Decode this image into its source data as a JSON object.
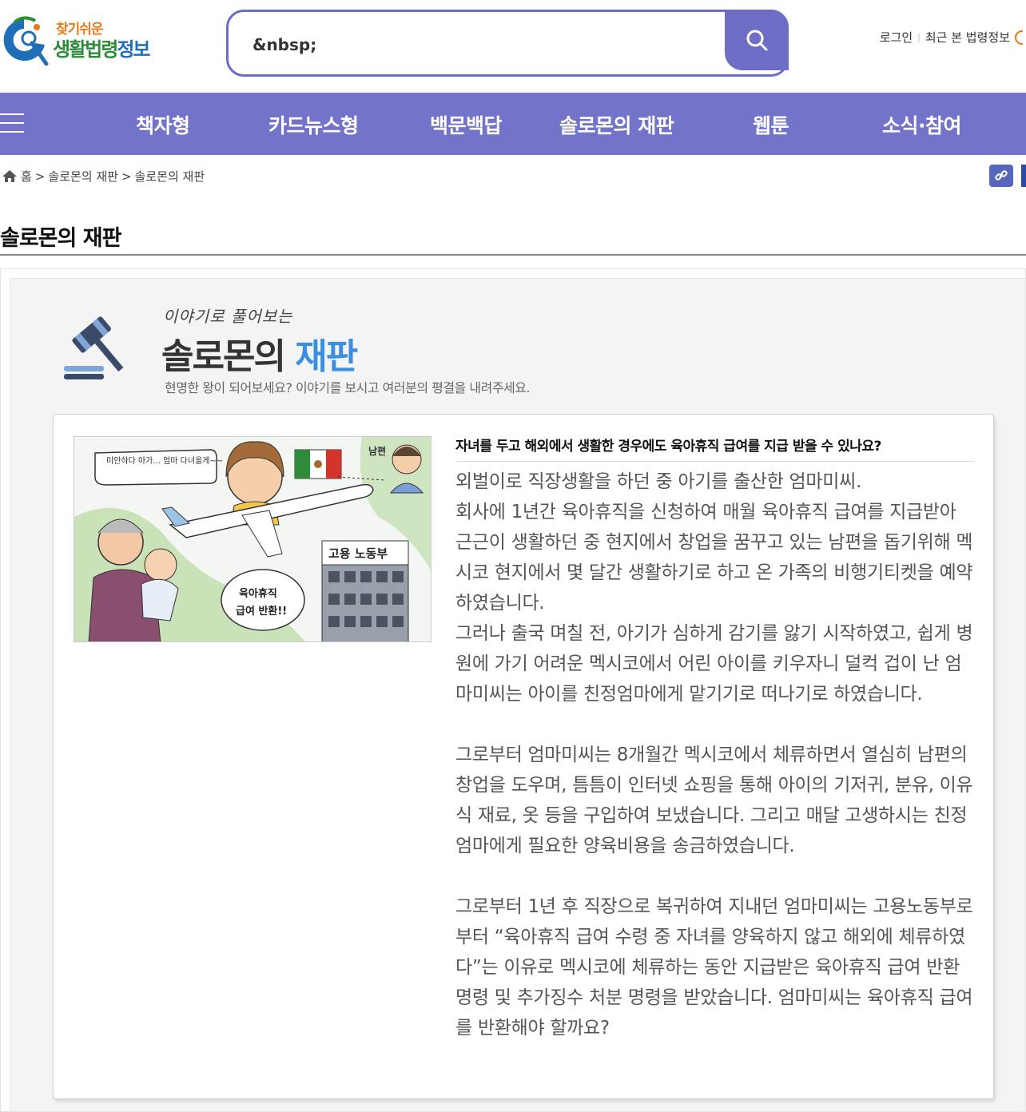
{
  "logo": {
    "top": "찾기쉬운",
    "main_green": "생활법령",
    "main_blue": "정보"
  },
  "search": {
    "value": "&nbsp;",
    "placeholder": ""
  },
  "util": {
    "login": "로그인",
    "recent": "최근 본 법령정보"
  },
  "nav": {
    "items": [
      "책자형",
      "카드뉴스형",
      "백문백답",
      "솔로몬의 재판",
      "웹툰",
      "소식·참여"
    ]
  },
  "breadcrumb": {
    "home": "홈",
    "sep": ">",
    "level1": "솔로몬의 재판",
    "level2": "솔로몬의 재판"
  },
  "page_title": "솔로몬의 재판",
  "banner": {
    "subtitle": "이야기로 풀어보는",
    "title_main": "솔로몬의",
    "title_accent": "재판",
    "description": "현명한 왕이 되어보세요? 이야기를 보시고 여러분의 평결을 내려주세요."
  },
  "cartoon": {
    "speech1": "미안하다 아가... 엄마 다녀올게~~",
    "husband_label": "남편",
    "ministry": "고용 노동부",
    "speech2a": "육아휴직",
    "speech2b": "급여 반환!!"
  },
  "question": "자녀를 두고 해외에서 생활한 경우에도 육아휴직 급여를 지급 받을 수 있나요?",
  "story": {
    "p1": [
      "외벌이로 직장생활을 하던 중 아기를 출산한 엄마미씨.",
      "회사에 1년간 육아휴직을 신청하여 매월 육아휴직 급여를 지급받아 근근이 생활하던 중 현지에서 창업을 꿈꾸고 있는 남편을 돕기위해 멕시코 현지에서 몇 달간 생활하기로 하고 온 가족의 비행기티켓을 예약하였습니다.",
      "그러나 출국 며칠 전, 아기가 심하게 감기를 앓기 시작하였고, 쉽게 병원에 가기 어려운 멕시코에서 어린 아이를 키우자니 덜컥 겁이 난 엄마미씨는 아이를 친정엄마에게 맡기기로 떠나기로 하였습니다."
    ],
    "p2": "그로부터 엄마미씨는 8개월간 멕시코에서 체류하면서 열심히 남편의 창업을 도우며, 틈틈이 인터넷 쇼핑을 통해 아이의 기저귀, 분유, 이유식 재료, 옷 등을 구입하여 보냈습니다. 그리고 매달 고생하시는 친정엄마에게 필요한 양육비용을 송금하였습니다.",
    "p3": "그로부터 1년 후 직장으로 복귀하여 지내던 엄마미씨는 고용노동부로부터 “육아휴직 급여 수령 중 자녀를 양육하지 않고 해외에 체류하였다”는 이유로 멕시코에 체류하는 동안 지급받은 육아휴직 급여 반환명령 및 추가징수 처분 명령을 받았습니다. 엄마미씨는 육아휴직 급여를 반환해야 할까요?"
  },
  "colors": {
    "nav_bg": "#7373c9",
    "search_border": "#6b6bc9",
    "accent_blue": "#3b8fe0",
    "logo_orange": "#e87a1c",
    "logo_green": "#2e8b3a"
  }
}
